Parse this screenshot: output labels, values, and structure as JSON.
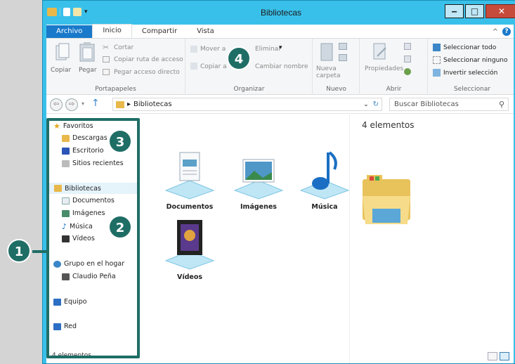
{
  "window": {
    "title": "Bibliotecas"
  },
  "ribbon_tabs": [
    "Archivo",
    "Inicio",
    "Compartir",
    "Vista"
  ],
  "ribbon": {
    "portapapeles": {
      "copy": "Copiar",
      "paste": "Pegar",
      "cut": "Cortar",
      "copy_path": "Copiar ruta de acceso",
      "paste_shortcut": "Pegar acceso directo",
      "label": "Portapapeles"
    },
    "organizar": {
      "move_to": "Mover a",
      "copy_to": "Copiar a",
      "delete": "Eliminar",
      "rename": "Cambiar nombre",
      "label": "Organizar"
    },
    "nuevo": {
      "new_folder": "Nueva carpeta",
      "label": "Nuevo"
    },
    "abrir": {
      "properties": "Propiedades",
      "label": "Abrir"
    },
    "seleccionar": {
      "select_all": "Seleccionar todo",
      "select_none": "Seleccionar ninguno",
      "invert": "Invertir selección",
      "label": "Seleccionar"
    }
  },
  "address": {
    "path": "Bibliotecas",
    "search_placeholder": "Buscar Bibliotecas"
  },
  "nav": {
    "favorites": "Favoritos",
    "downloads": "Descargas",
    "desktop": "Escritorio",
    "recent": "Sitios recientes",
    "libraries": "Bibliotecas",
    "documents": "Documentos",
    "images": "Imágenes",
    "music": "Música",
    "videos": "Vídeos",
    "homegroup": "Grupo en el hogar",
    "user": "Claudio Peña",
    "computer": "Equipo",
    "network": "Red"
  },
  "status": "4 elementos",
  "content": {
    "count": "4 elementos",
    "items": [
      "Documentos",
      "Imágenes",
      "Música",
      "Vídeos"
    ]
  },
  "callouts": [
    "1",
    "2",
    "3",
    "4"
  ],
  "colors": {
    "accent": "#1f6e66",
    "titlebar": "#39c0ea",
    "file_tab": "#1979ca"
  }
}
